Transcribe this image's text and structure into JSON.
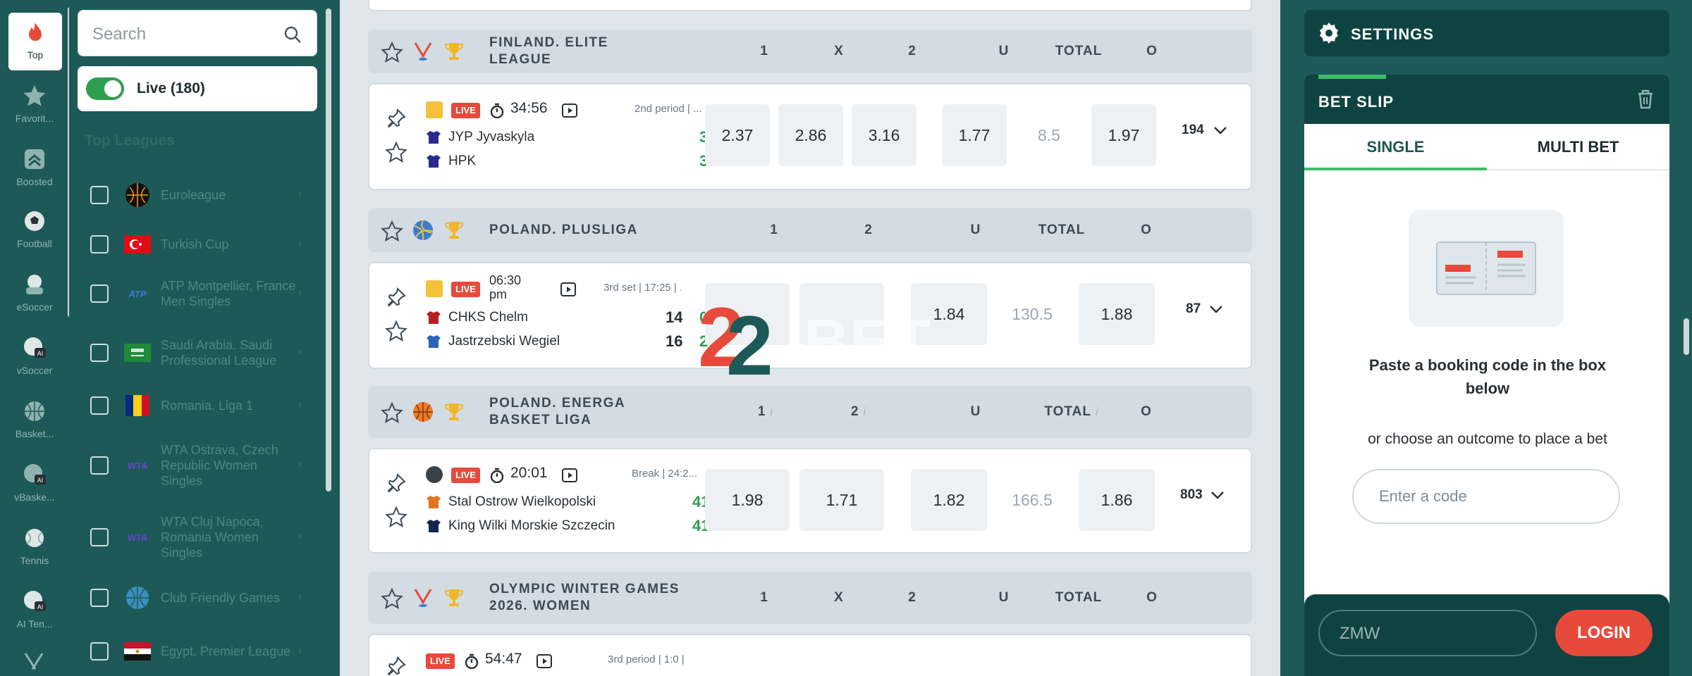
{
  "sports": [
    {
      "label": "Top",
      "icon": "flame-icon",
      "active": true
    },
    {
      "label": "Favorit...",
      "icon": "star-icon"
    },
    {
      "label": "Boosted",
      "icon": "boost-icon"
    },
    {
      "label": "Football",
      "icon": "football-icon"
    },
    {
      "label": "eSoccer",
      "icon": "esoccer-icon"
    },
    {
      "label": "vSoccer",
      "icon": "vsoccer-icon"
    },
    {
      "label": "Basket...",
      "icon": "basketball-icon"
    },
    {
      "label": "vBaske...",
      "icon": "vbasketball-icon"
    },
    {
      "label": "Tennis",
      "icon": "tennis-icon"
    },
    {
      "label": "AI Ten...",
      "icon": "ai-tennis-icon"
    }
  ],
  "search": {
    "placeholder": "Search"
  },
  "live_toggle": {
    "label": "Live (180)",
    "on": true
  },
  "top_leagues": {
    "title": "Top Leagues",
    "items": [
      {
        "name": "Euroleague",
        "icon": "euroleague-icon"
      },
      {
        "name": "Turkish Cup",
        "icon": "turkey-flag-icon"
      },
      {
        "name": "ATP Montpellier, France Men Singles",
        "icon": "atp-icon"
      },
      {
        "name": "Saudi Arabia. Saudi Professional League",
        "icon": "saudi-flag-icon"
      },
      {
        "name": "Romania. Liga 1",
        "icon": "romania-flag-icon"
      },
      {
        "name": "WTA Ostrava, Czech Republic Women Singles",
        "icon": "wta-icon"
      },
      {
        "name": "WTA Cluj Napoca, Romania Women Singles",
        "icon": "wta-icon"
      },
      {
        "name": "Club Friendly Games",
        "icon": "globe-icon"
      },
      {
        "name": "Egypt. Premier League",
        "icon": "egypt-flag-icon"
      }
    ]
  },
  "leagues": [
    {
      "name": "FINLAND. ELITE LEAGUE",
      "sport_icon": "hockey-icon",
      "columns": [
        "1",
        "X",
        "2",
        "U",
        "TOTAL",
        "O"
      ],
      "match": {
        "status": "LIVE",
        "time": "34:56",
        "period": "2nd period | ...",
        "team1": {
          "name": "JYP Jyvaskyla",
          "score": "3"
        },
        "team2": {
          "name": "HPK",
          "score": "3"
        },
        "odds": [
          "2.37",
          "2.86",
          "3.16",
          "1.77",
          "8.5",
          "1.97"
        ],
        "markets": "194"
      }
    },
    {
      "name": "POLAND. PLUSLIGA",
      "sport_icon": "volleyball-icon",
      "columns": [
        "1",
        "2",
        "U",
        "TOTAL",
        "O"
      ],
      "match": {
        "status": "LIVE",
        "time": "06:30 pm",
        "period": "3rd set | 17:25 | ...",
        "team1": {
          "name": "CHKS Chelm",
          "score": "14",
          "set": "0"
        },
        "team2": {
          "name": "Jastrzebski Wegiel",
          "score": "16",
          "set": "2"
        },
        "odds": [
          "",
          "",
          "1.84",
          "130.5",
          "1.88"
        ],
        "markets": "87"
      }
    },
    {
      "name": "POLAND. ENERGA BASKET LIGA",
      "sport_icon": "basketball-icon",
      "columns": [
        "1",
        "2",
        "U",
        "TOTAL",
        "O"
      ],
      "match": {
        "status": "LIVE",
        "time": "20:01",
        "period": "Break | 24:2...",
        "team1": {
          "name": "Stal Ostrow Wielkopolski",
          "score": "41"
        },
        "team2": {
          "name": "King Wilki Morskie Szczecin",
          "score": "41"
        },
        "odds": [
          "1.98",
          "1.71",
          "1.82",
          "166.5",
          "1.86"
        ],
        "markets": "803"
      }
    },
    {
      "name": "OLYMPIC WINTER GAMES 2026. WOMEN",
      "sport_icon": "hockey-icon",
      "columns": [
        "1",
        "X",
        "2",
        "U",
        "TOTAL",
        "O"
      ],
      "match": {
        "status": "LIVE",
        "time": "54:47",
        "period": "3rd period | 1:0 | ..."
      }
    }
  ],
  "settings": {
    "label": "SETTINGS"
  },
  "betslip": {
    "title": "BET SLIP",
    "tabs": [
      "SINGLE",
      "MULTI BET"
    ],
    "paste_text": "Paste a booking code in the box below",
    "choose_text": "or choose an outcome to place a bet",
    "code_placeholder": "Enter a code",
    "currency": "ZMW",
    "login": "LOGIN"
  },
  "colors": {
    "brand": "#1d5a57",
    "dark": "#0f4341",
    "accent": "#e64a3b",
    "green": "#2e9e51"
  }
}
